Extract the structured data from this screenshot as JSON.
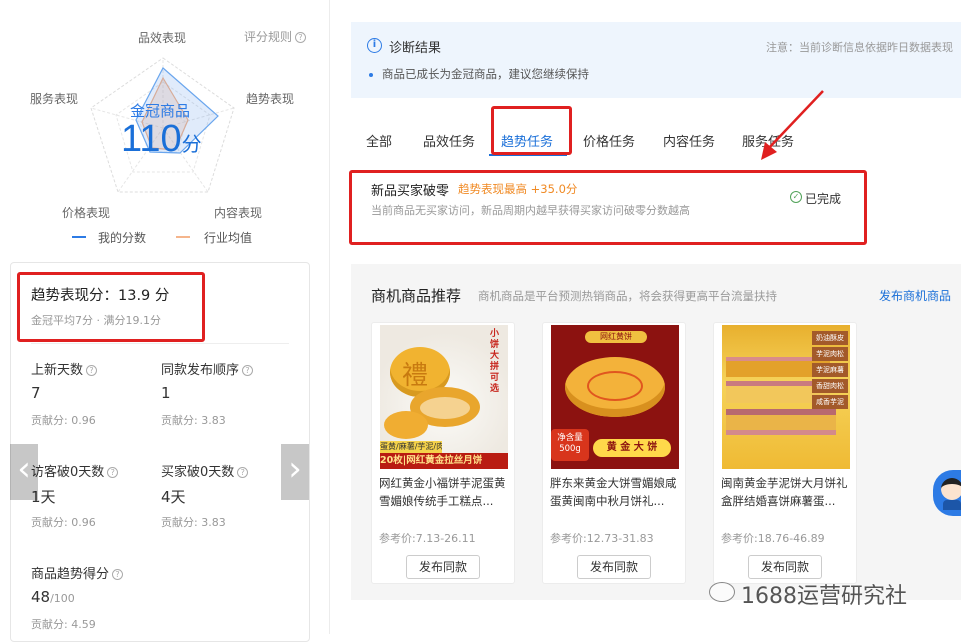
{
  "radar": {
    "labels": {
      "top": "品效表现",
      "left": "服务表现",
      "right": "趋势表现",
      "bottom_left": "价格表现",
      "bottom_right": "内容表现"
    },
    "rules_link": "评分规则",
    "center_badge": "金冠商品",
    "score": "110",
    "score_unit": "分",
    "legend": [
      {
        "label": "我的分数",
        "color": "#2d7be5"
      },
      {
        "label": "行业均值",
        "color": "#f5b58c"
      }
    ]
  },
  "score_card": {
    "title": "趋势表现分：13.9 分",
    "subtitle": "金冠平均7分 · 满分19.1分",
    "metrics": [
      {
        "label": "上新天数",
        "value": "7",
        "contribution": "贡献分: 0.96"
      },
      {
        "label": "同款发布顺序",
        "value": "1",
        "contribution": "贡献分: 3.83"
      },
      {
        "label": "访客破0天数",
        "value": "1天",
        "contribution": "贡献分: 0.96"
      },
      {
        "label": "买家破0天数",
        "value": "4天",
        "contribution": "贡献分: 3.83"
      }
    ],
    "overall": {
      "label": "商品趋势得分",
      "value": "48",
      "value_suffix": "/100",
      "contribution": "贡献分: 4.59"
    },
    "nav_left": "‹",
    "nav_right": "›"
  },
  "diagnosis": {
    "title": "诊断结果",
    "note": "注意：当前诊断信息依据昨日数据表现",
    "bullet": "商品已成长为金冠商品，建议您继续保持"
  },
  "tabs": [
    "全部",
    "品效任务",
    "趋势任务",
    "价格任务",
    "内容任务",
    "服务任务"
  ],
  "active_tab": 2,
  "task": {
    "title": "新品买家破零",
    "tag": "趋势表现最高 +35.0分",
    "desc": "当前商品无买家访问，新品周期内越早获得买家访问破零分数越高",
    "status": "已完成"
  },
  "opportunity": {
    "title": "商机商品推荐",
    "subtitle": "商机商品是平台预测热销商品，将会获得更高平台流量扶持",
    "publish_link": "发布商机商品",
    "products": [
      {
        "title": "网红黄金小福饼芋泥蛋黄雪媚娘传统手工糕点...",
        "price": "参考价:7.13-26.11",
        "button": "发布同款",
        "img_text": [
          "小",
          "饼",
          "大",
          "拼",
          "可",
          "选"
        ],
        "img_caption": "20枚|网红黄金拉丝月饼",
        "img_tag": "蛋黄/麻薯/芋泥/肉松",
        "img_char": "禮"
      },
      {
        "title": "胖东来黄金大饼雪媚娘咸蛋黄闽南中秋月饼礼...",
        "price": "参考价:12.73-31.83",
        "button": "发布同款",
        "img_top": "网红黄饼",
        "img_caption": "黄 金 大 饼",
        "img_tag": "净含量 500g"
      },
      {
        "title": "闽南黄金芋泥饼大月饼礼盒胖结婚喜饼麻薯蛋...",
        "price": "参考价:18.76-46.89",
        "button": "发布同款",
        "img_tags": [
          "奶油酥皮",
          "芋泥肉松",
          "芋泥麻薯",
          "香甜肉松",
          "咸香芋泥"
        ]
      }
    ]
  },
  "watermark": "1688运营研究社",
  "colors": {
    "accent_blue": "#1a6fd8",
    "highlight_red": "#e02020",
    "tag_orange": "#f08a24",
    "success_green": "#52a35a",
    "diagnosis_bg": "#eef5fd"
  }
}
